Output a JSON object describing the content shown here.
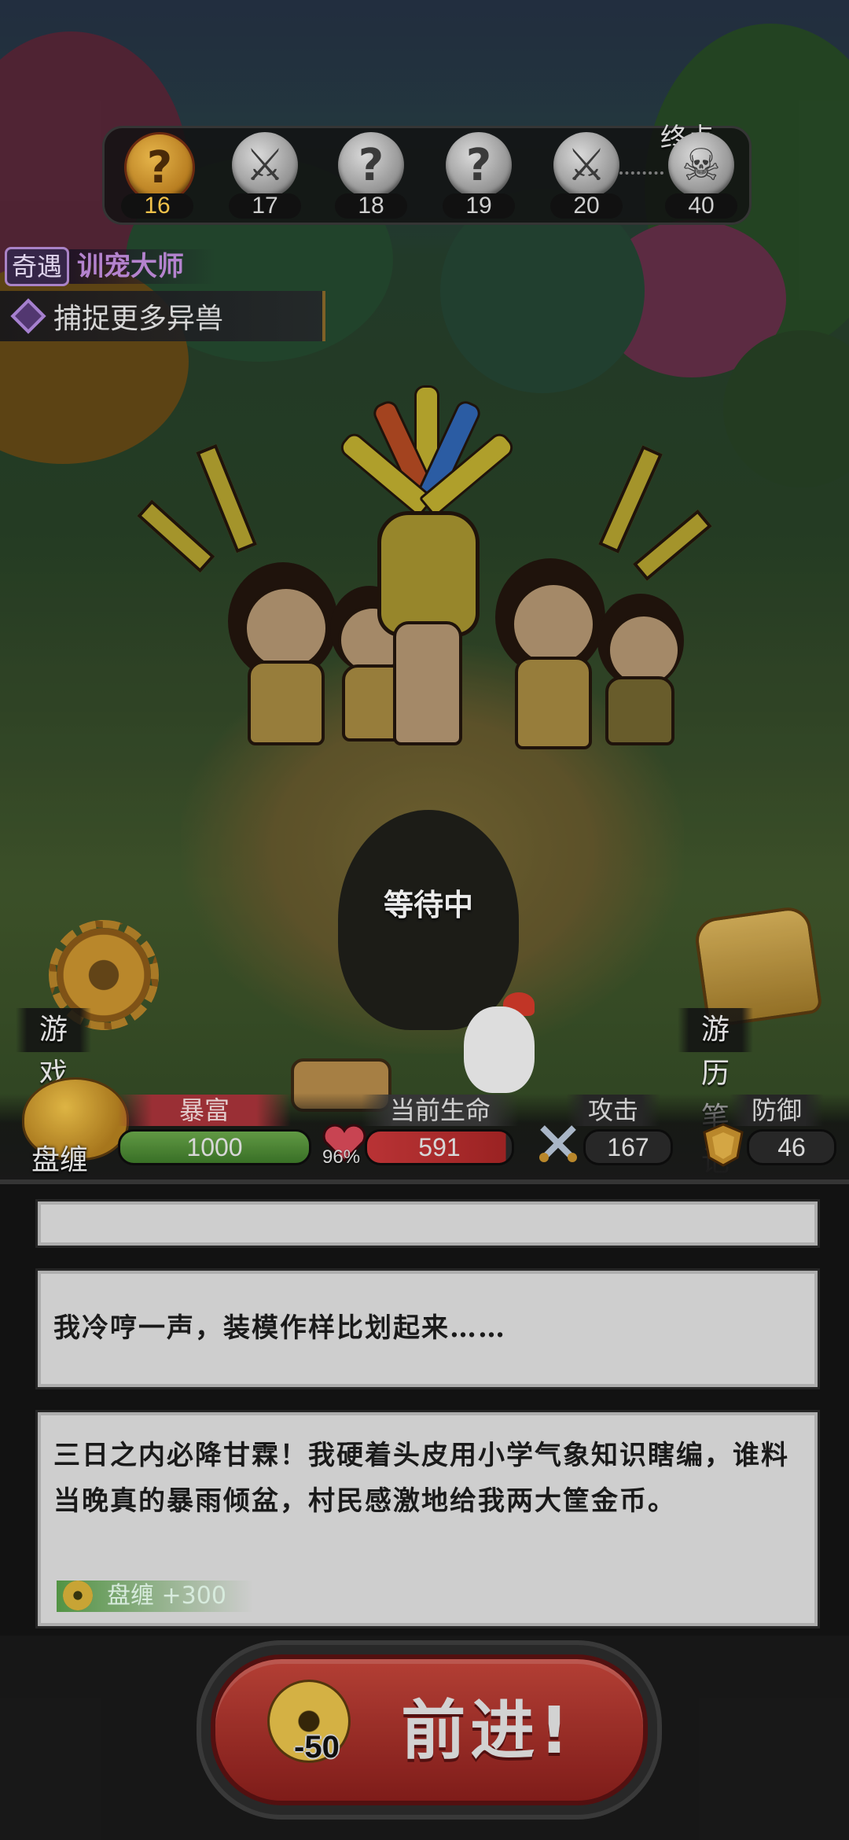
{
  "progress": {
    "nodes": [
      {
        "icon": "question-icon",
        "number": "16",
        "current": true
      },
      {
        "icon": "crossed-swords-icon",
        "number": "17",
        "current": false
      },
      {
        "icon": "question-icon",
        "number": "18",
        "current": false
      },
      {
        "icon": "question-icon",
        "number": "19",
        "current": false
      },
      {
        "icon": "crossed-swords-icon",
        "number": "20",
        "current": false
      },
      {
        "icon": "skull-icon",
        "number": "40",
        "current": false
      }
    ],
    "end_label": "终点"
  },
  "event": {
    "badge": "奇遇",
    "name": "训宠大师",
    "quest": "捕捉更多异兽"
  },
  "scene": {
    "status": "等待中"
  },
  "buttons": {
    "settings": "游戏设置",
    "notes": "游历笔记"
  },
  "stats": {
    "currency_name": "盘缠",
    "rich_label": "暴富",
    "gold_value": "1000",
    "life_label": "当前生命",
    "hp_percent": "96%",
    "hp_value": "591",
    "hp_fraction": 0.96,
    "attack_label": "攻击",
    "attack_value": "167",
    "defense_label": "防御",
    "defense_value": "46"
  },
  "log": {
    "entries": [
      {
        "text": "我冷哼一声，装模作样比划起来……"
      },
      {
        "text": "三日之内必降甘霖！我硬着头皮用小学气象知识瞎编，谁料当晚真的暴雨倾盆，村民感激地给我两大筐金币。"
      }
    ],
    "reward_label": "盘缠",
    "reward_amount": "+300"
  },
  "advance": {
    "label": "前进!",
    "cost": "-50"
  },
  "colors": {
    "accent_gold": "#e6b54a",
    "hp_red": "#d84a4a",
    "gold_green": "#6aa64a",
    "event_purple": "#c48fe0"
  }
}
